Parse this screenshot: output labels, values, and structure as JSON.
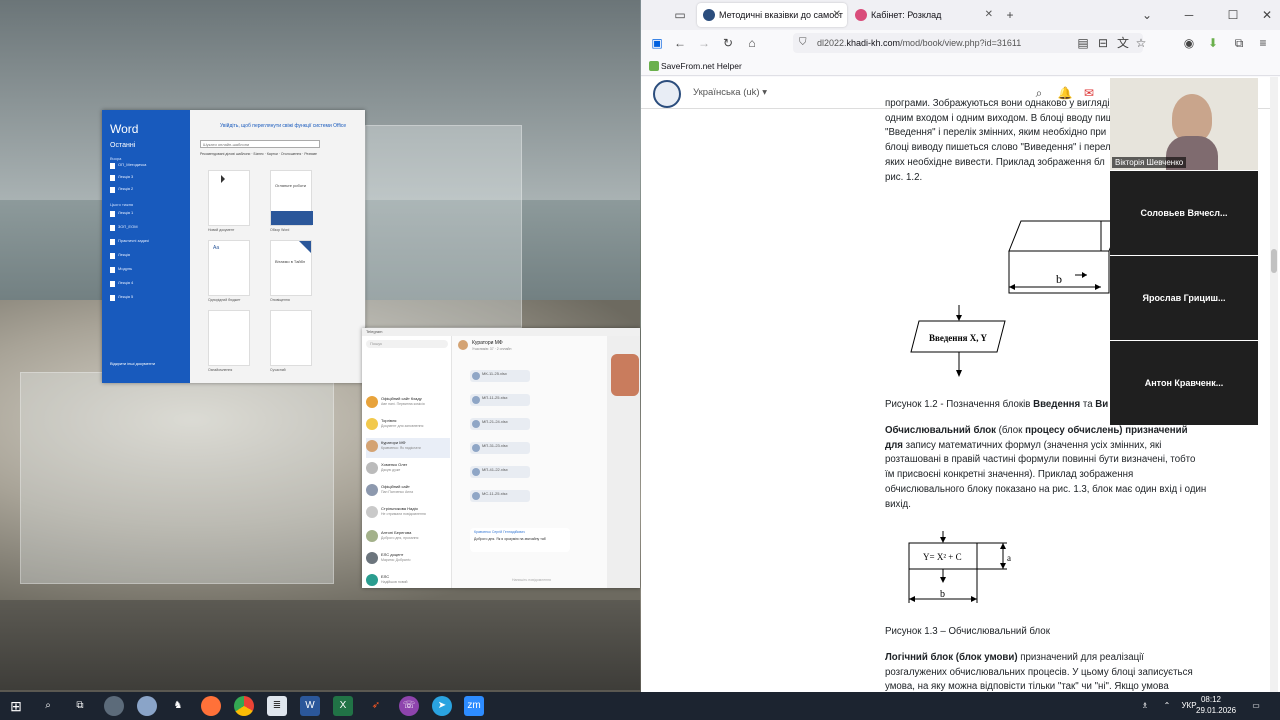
{
  "word": {
    "app_name": "Word",
    "recent_label": "Останні",
    "welcome": "Увійдіть, щоб переглянути свіжі функції системи Office",
    "search_placeholder": "Шукати онлайн-шаблони",
    "categories": "Рекомендовані ділові шаблони · Бізнес · Картки · Оголошення · Резюме",
    "groups": [
      "Вчора",
      "Цього тижня"
    ],
    "recent_items": [
      "ОП_Методичка",
      "Лекція 3",
      "Лекція 2",
      "Лекція 1",
      "3ОП_ЕОМ",
      "Практичні задачі",
      "Лекція",
      "Модуль",
      "Лекція 4",
      "Лекція 5"
    ],
    "templates": [
      "Новий документ",
      "Огляньте",
      "Вітаємо",
      "Загальний шаблон",
      "Сучасний",
      "Гострий"
    ],
    "template_labels": [
      "Новий документ",
      "Обзор Word",
      "Однорідний бюджет",
      "Оповіщення",
      "Ознайомлення",
      "Сучасний"
    ],
    "tpl_text_1": "Огляньте роботи",
    "tpl_text_2": "Вітаємо в Тайбл",
    "open_more": "Відкрити інші документи"
  },
  "telegram": {
    "title": "Telegram",
    "search": "Пошук",
    "chat_title": "Куратори МФ",
    "chat_subtitle": "Учасників: 37 · 2 онлайн",
    "chats": [
      {
        "name": "Офіційний сайт Кхаду",
        "msg": "Аве пані. Первинна комісія"
      },
      {
        "name": "Торгівля",
        "msg": "Документ для заповнення"
      },
      {
        "name": "Куратори МФ",
        "msg": "Кравченко: Як надіслати"
      },
      {
        "name": "Хоменко Олег",
        "msg": "Дякую дуже"
      },
      {
        "name": "Офіційний сайт",
        "msg": "Пан Панченко Анна"
      },
      {
        "name": "Стрільникова Надія",
        "msg": "Не отримали повідомлення"
      },
      {
        "name": "Антоні Берегова",
        "msg": "Доброго дня, прохання"
      },
      {
        "name": "ЕЛС доцент",
        "msg": "Марина: Добраніч"
      },
      {
        "name": "ЕЛС",
        "msg": "Надійшов новий"
      }
    ],
    "files": [
      "МК-11-25.xlsx",
      "МП-11-25.xlsx",
      "МП-21-24.xlsx",
      "МП-31-23.xlsx",
      "МП-41-22.xlsx",
      "МС-11-25.xlsx"
    ],
    "sender": "Кравченко Сергій Геннадійович",
    "message": "Доброго дня. Як я зрозумію на звичайну таб",
    "input_placeholder": "Напишіть повідомлення"
  },
  "browser": {
    "tabs": [
      {
        "title": "Методичні вказівки до самост",
        "active": true
      },
      {
        "title": "Кабінет: Розклад",
        "active": false
      }
    ],
    "url_prefix": "dl2022.",
    "url_domain": "khadi-kh.com",
    "url_rest": "/mod/book/view.php?id=31611",
    "bookmark": "SaveFrom.net Helper",
    "language": "Українська (uk) ▾"
  },
  "page": {
    "p1_lines": [
      "програми. Зображуються вони однаково у вигляді",
      "одним входом і одним виходом. В блоці вводу пише",
      "\"Введення\" і перелік змінних, яким необхідно при",
      "блоці виводу пишеться слово \"Виведення\" і перел",
      "яких необхідне вивести. Приклад зображення бл",
      "рис. 1.2."
    ],
    "fig2_label_b": "b",
    "fig2_block": "Введення X, Y",
    "caption2_prefix": "Рисунок 1.2 - Позначення блоків ",
    "caption2_bold": "Введення",
    "caption2_mid": " та ",
    "caption2_bold2": "Ви",
    "p2_b1": "Обчислювальний блок",
    "p2_t1": " (блок ",
    "p2_b2": "процесу обчислень) призначений",
    "p2_b3": "для",
    "p2_t2": " запису математичних формул (значення усіх змінних, які розташовані в правій частині формули повинні бути визначені, тобто їм присвоєні конкретні значення). Приклад зображення обчислювального блоку показано на рис. 1.3, блок має один вхід і один вихід.",
    "fig3_formula": "Y= X² + C",
    "fig3_a": "a",
    "fig3_b": "b",
    "caption3": "Рисунок 1.3 – Обчислювальний блок",
    "p3_b1": "Логічний блок (блок умови)",
    "p3_t1": " призначений для реалізації розгалужених обчислювальних процесів. У цьому блоці записується умова, на яку можна відповісти тільки \"так\" чи \"ні\". Якщо умова"
  },
  "call": {
    "main_name": "Вікторія Шевченко",
    "participants": [
      "Соловьев  Вячесл...",
      "Ярослав  Грициш...",
      "Антон  Кравченк..."
    ]
  },
  "taskbar": {
    "lang": "УКР",
    "time": "08:12",
    "date": "29.01.2026",
    "zoom_label": "zm"
  }
}
